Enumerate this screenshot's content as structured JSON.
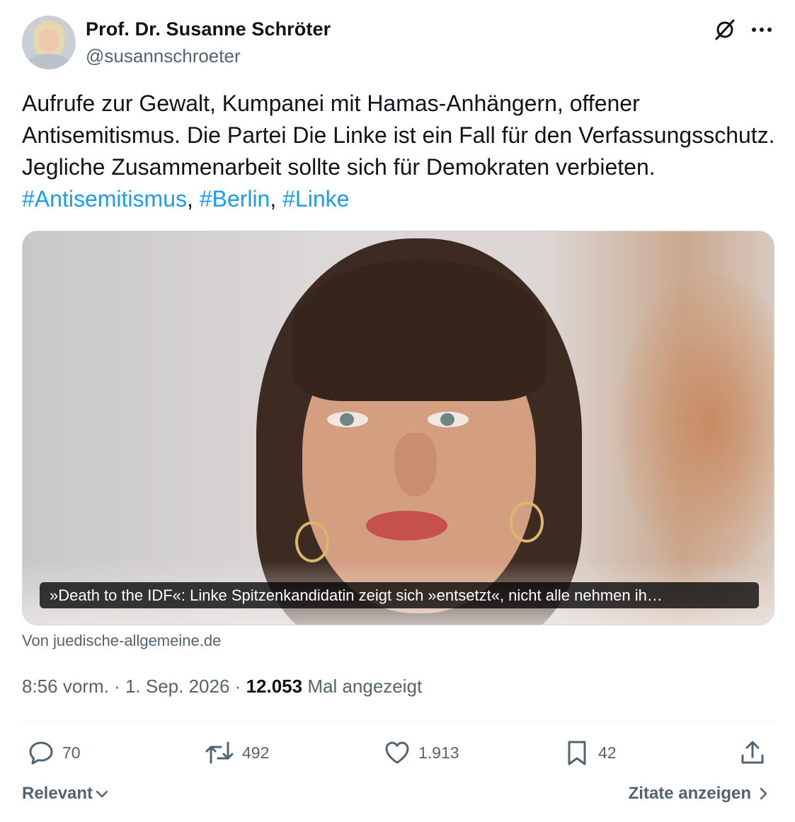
{
  "author": {
    "name": "Prof. Dr. Susanne Schröter",
    "handle": "@susannschroeter"
  },
  "tweet": {
    "text": "Aufrufe zur Gewalt, Kumpanei mit Hamas-Anhängern, offener Antisemitismus. Die Partei Die Linke ist ein Fall für den Verfassungsschutz. Jegliche Zusammenarbeit sollte sich für Demokraten verbieten. ",
    "hashtags": [
      "#Antisemitismus",
      "#Berlin",
      "#Linke"
    ],
    "separator": ", "
  },
  "link_card": {
    "caption": "»Death to the IDF«: Linke Spitzenkandidatin zeigt sich »entsetzt«, nicht alle nehmen ih…",
    "source": "Von juedische-allgemeine.de"
  },
  "meta": {
    "time": "8:56 vorm.",
    "dot": "·",
    "date": "1. Sep. 2026",
    "views": "12.053",
    "views_label": "Mal angezeigt"
  },
  "actions": {
    "replies": "70",
    "retweets": "492",
    "likes": "1.913",
    "bookmarks": "42"
  },
  "footer": {
    "sort_label": "Relevant",
    "quotes_label": "Zitate anzeigen"
  },
  "colors": {
    "link": "#1d9bf0",
    "secondary": "#536471",
    "primary_text": "#0f1419"
  },
  "icons": [
    "grok-icon",
    "more-icon",
    "reply-icon",
    "retweet-icon",
    "like-icon",
    "bookmark-icon",
    "share-icon",
    "chevron-down-icon",
    "chevron-right-icon"
  ]
}
